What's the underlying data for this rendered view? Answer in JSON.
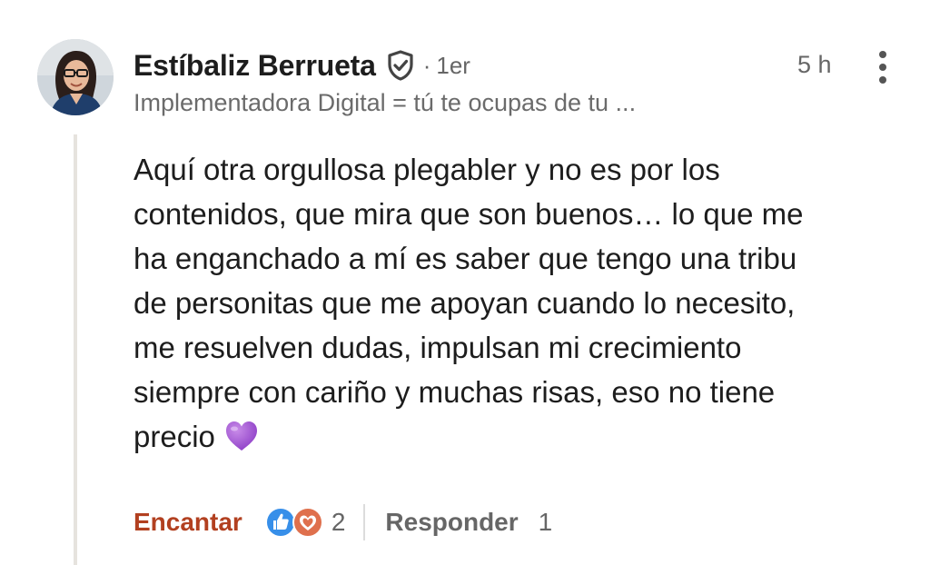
{
  "comment": {
    "author": {
      "name": "Estíbaliz Berrueta",
      "separator": "·",
      "connection_degree": "1er",
      "headline": "Implementadora Digital = tú te ocupas de tu ..."
    },
    "timestamp": "5 h",
    "body": "Aquí otra orgullosa plegabler y no es por los\ncontenidos, que mira que son buenos… lo que me\nha enganchado a mí es saber que tengo una tribu\nde personitas que me apoyan cuando lo necesito,\nme resuelven dudas, impulsan mi crecimiento\nsiempre con cariño y muchas risas, eso no tiene\nprecio",
    "emoji": "purple-heart-emoji",
    "actions": {
      "react_label": "Encantar",
      "reaction_icons": [
        "like-icon",
        "love-icon"
      ],
      "reaction_count": "2",
      "reply_label": "Responder",
      "reply_count": "1"
    }
  },
  "colors": {
    "react_accent": "#b24020",
    "like_blue": "#378fe9",
    "love_orange": "#df704d",
    "emoji_purple": "#a35ad8",
    "thread_line": "#e6e3de"
  }
}
